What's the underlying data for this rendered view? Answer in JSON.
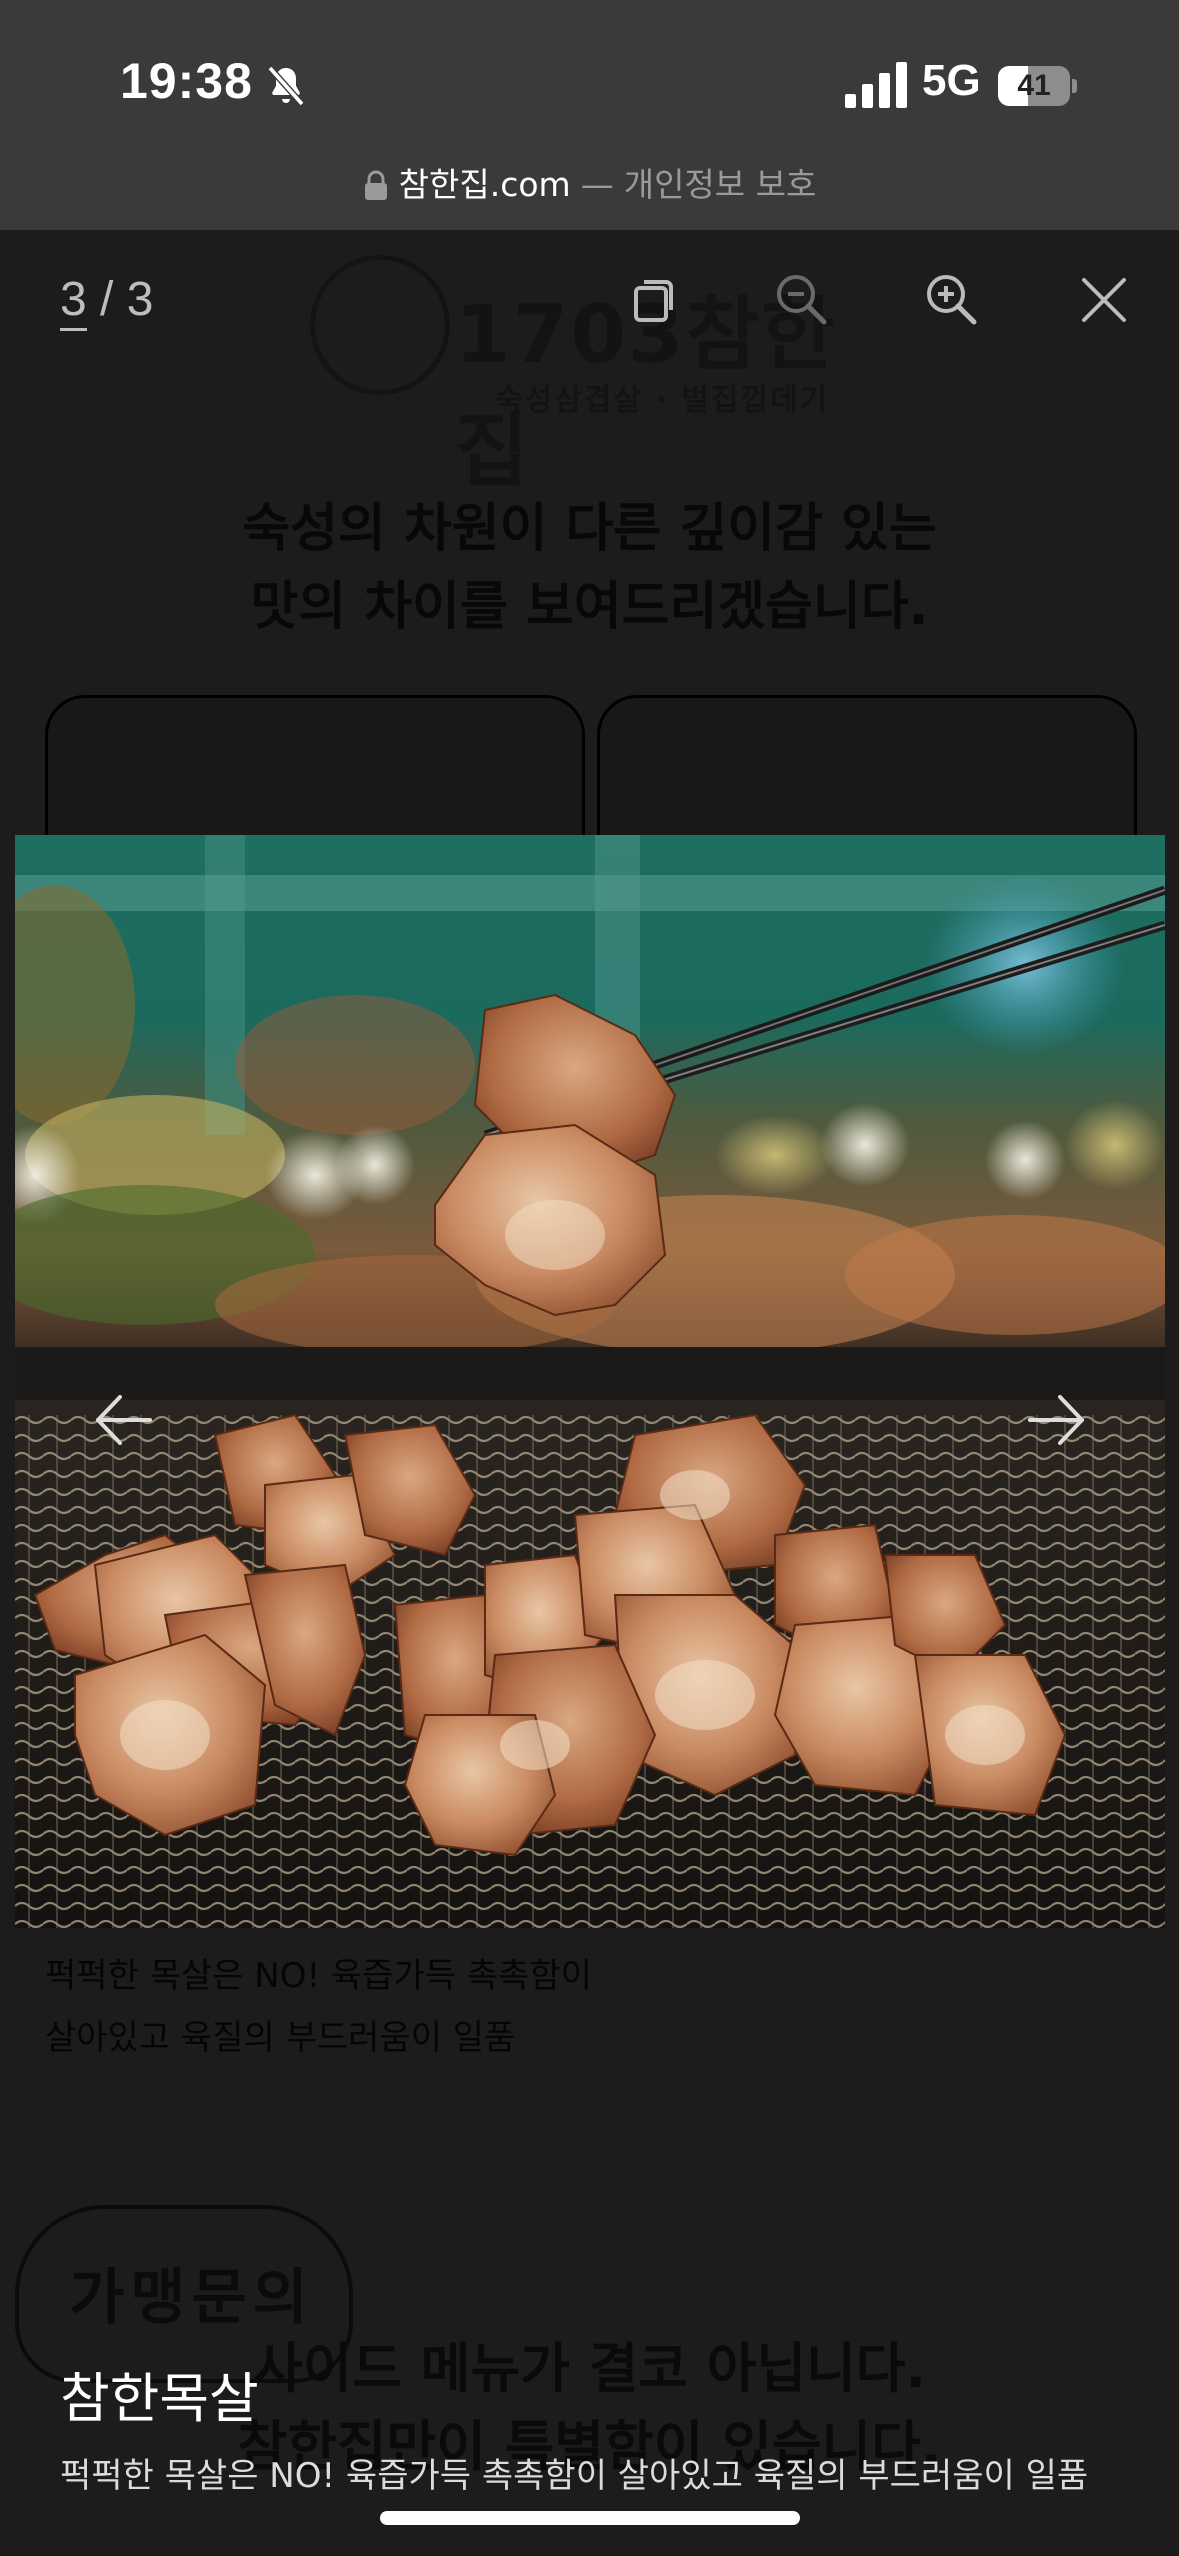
{
  "status_bar": {
    "time": "19:38",
    "network": "5G",
    "battery": "41",
    "battery_level": 0.41
  },
  "address_bar": {
    "domain": "참한집.com",
    "separator": "—",
    "note": "개인정보 보호"
  },
  "background_page": {
    "logo_number": "1703",
    "logo_name": "참한집",
    "logo_tagline": "숙성삼겹살 · 벌집껍데기",
    "headline_line1": "숙성의 차원이 다른 깊이감 있는",
    "headline_line2": "맛의 차이를 보여드리겠습니다.",
    "card_description": "퍽퍽한 목살은 NO! 육즙가득 촉촉함이 살아있고 육질의 부드러움이 일품",
    "stamp_text": "가맹문의",
    "bottom_line1": "사이드 메뉴가 결코 아닙니다.",
    "bottom_line2": "참한집만이 특별함이 있습니다."
  },
  "lightbox": {
    "current": "3",
    "separator": "/",
    "total": "3",
    "icons": [
      "copy-icon",
      "zoom-out-icon",
      "zoom-in-icon",
      "close-icon",
      "arrow-left-icon",
      "arrow-right-icon"
    ],
    "caption_title": "참한목살",
    "caption_description": "퍽퍽한 목살은 NO! 육즙가득 촉촉함이 살아있고 육질의 부드러움이 일품"
  }
}
